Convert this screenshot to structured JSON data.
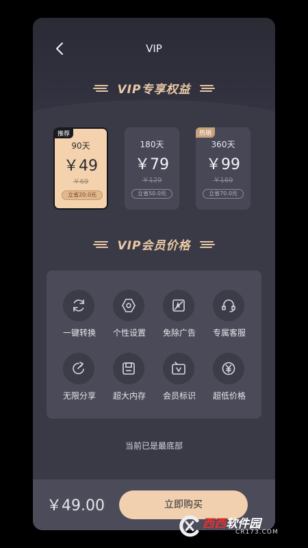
{
  "nav": {
    "title": "VIP"
  },
  "sections": {
    "benefits_title": "VIP专享权益",
    "price_title": "VIP会员价格"
  },
  "plans": [
    {
      "tag": "推荐",
      "days": "90天",
      "price": "￥49",
      "old_price": "￥69",
      "save": "立省20.0元",
      "selected": true
    },
    {
      "tag": "",
      "days": "180天",
      "price": "￥79",
      "old_price": "￥129",
      "save": "立省50.0元",
      "selected": false
    },
    {
      "tag": "热销",
      "days": "360天",
      "price": "￥99",
      "old_price": "￥169",
      "save": "立省70.0元",
      "selected": false
    }
  ],
  "benefits": [
    {
      "label": "一键转换",
      "icon": "refresh-icon"
    },
    {
      "label": "个性设置",
      "icon": "settings-icon"
    },
    {
      "label": "免除广告",
      "icon": "no-ads-icon"
    },
    {
      "label": "专属客服",
      "icon": "headset-icon"
    },
    {
      "label": "无限分享",
      "icon": "share-icon"
    },
    {
      "label": "超大内存",
      "icon": "storage-icon"
    },
    {
      "label": "会员标识",
      "icon": "vip-badge-icon"
    },
    {
      "label": "超低价格",
      "icon": "yen-icon"
    }
  ],
  "bottom_hint": "当前已是最底部",
  "footer": {
    "total": "￥49.00",
    "buy_label": "立即购买"
  },
  "watermark": {
    "title_red": "西西",
    "title_white": "软件园",
    "sub": "CR173.COM"
  },
  "colors": {
    "accent": "#f0d0ae",
    "background": "#3a3a47",
    "card": "#4a4a58"
  }
}
